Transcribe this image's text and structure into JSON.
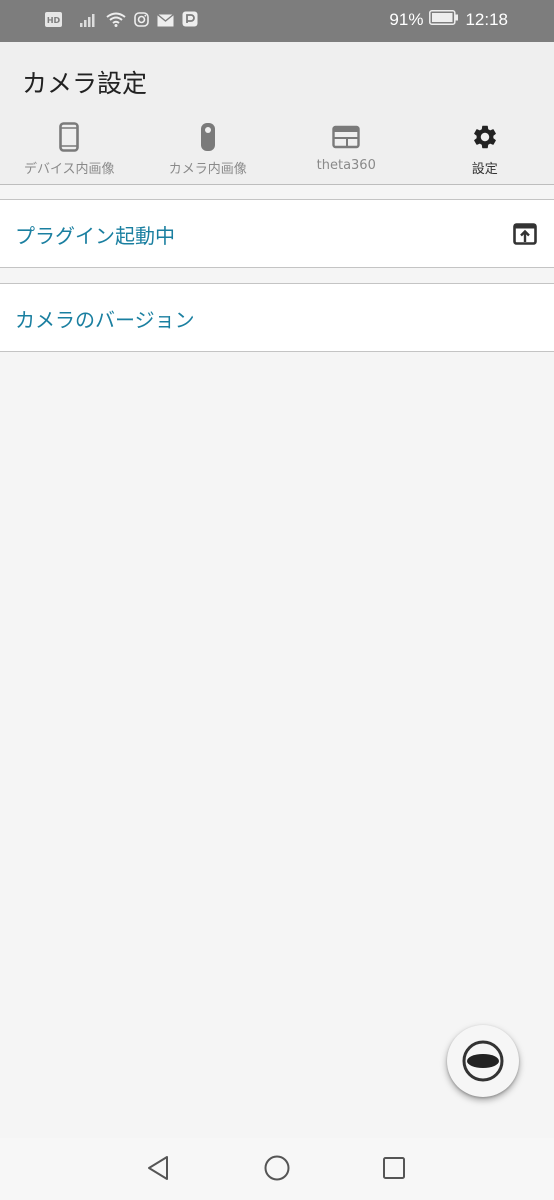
{
  "status_bar": {
    "hd_label": "HD",
    "battery": "91%",
    "time": "12:18",
    "icons": [
      "hd-icon",
      "signal-icon",
      "wifi-icon",
      "instagram-icon",
      "mail-icon",
      "paypay-icon",
      "battery-icon"
    ]
  },
  "header": {
    "title": "カメラ設定"
  },
  "tabs": [
    {
      "label": "デバイス内画像",
      "icon": "phone-icon"
    },
    {
      "label": "カメラ内画像",
      "icon": "camera-icon"
    },
    {
      "label": "theta360",
      "icon": "web-window-icon"
    },
    {
      "label": "設定",
      "icon": "gear-icon"
    }
  ],
  "active_tab": "設定",
  "settings": {
    "plugin_label": "プラグイン起動中",
    "plugin_icon": "open-in-new-icon",
    "version_label": "カメラのバージョン"
  },
  "fab": {
    "icon": "theta-lens-icon"
  },
  "nav": {
    "back_icon": "back-triangle-icon",
    "home_icon": "home-circle-icon",
    "recents_icon": "recents-square-icon"
  },
  "colors": {
    "accent_text": "#1a7fa0",
    "status_bar": "#7d7d7d",
    "header_bg": "#efefef"
  }
}
